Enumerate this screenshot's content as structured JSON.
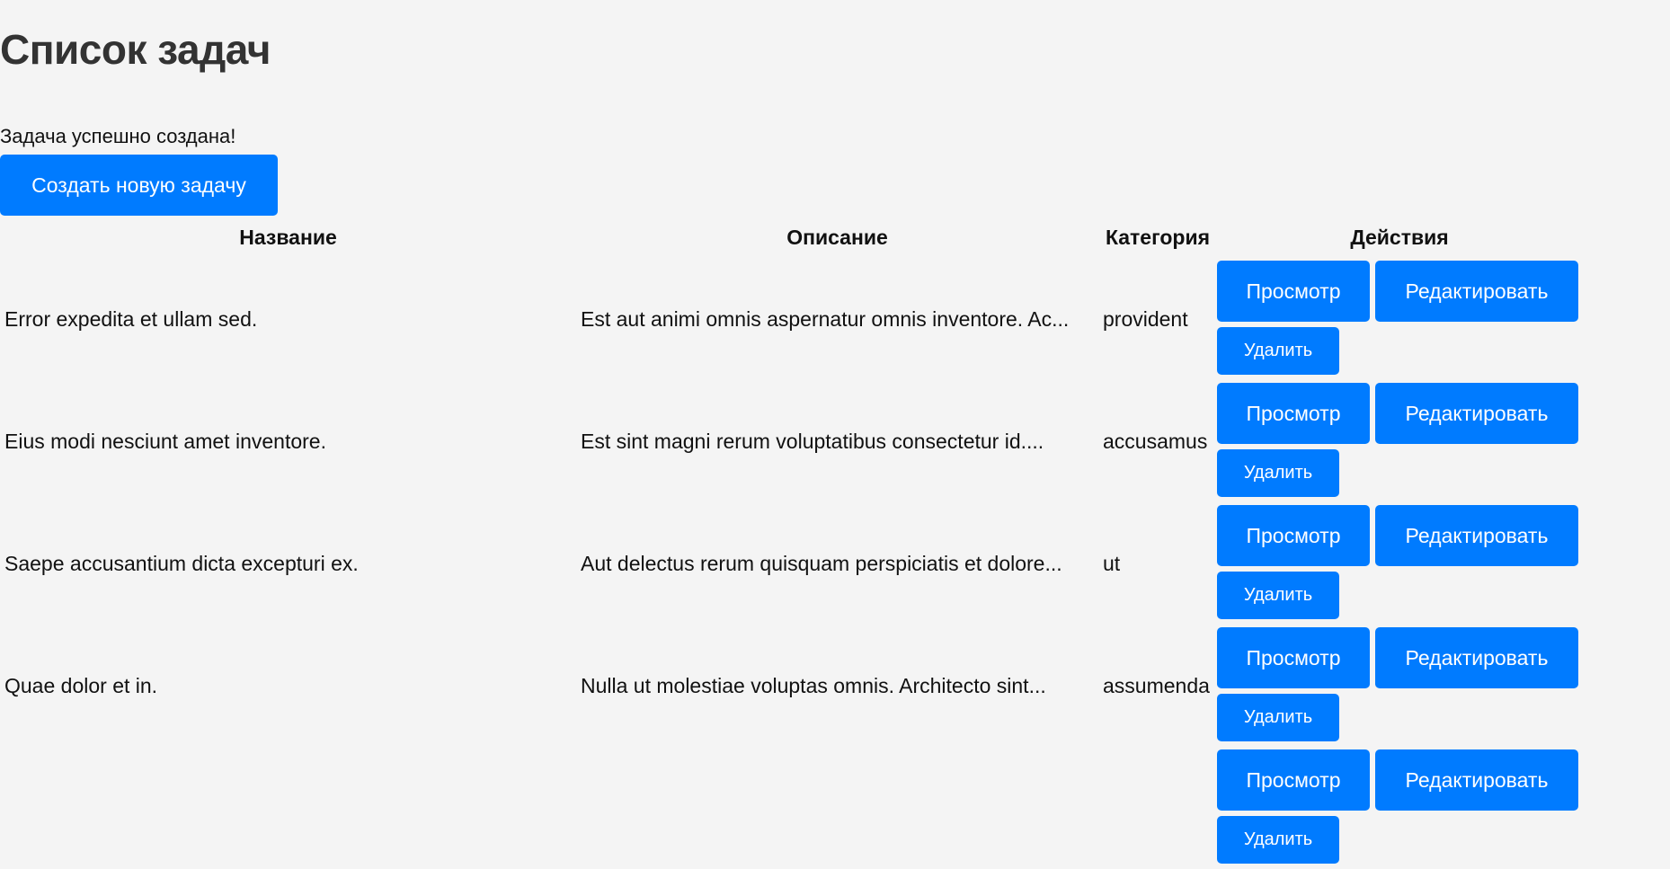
{
  "header": {
    "title": "Список задач"
  },
  "flash": {
    "message": "Задача успешно создана!"
  },
  "toolbar": {
    "create_label": "Создать новую задачу"
  },
  "table": {
    "columns": [
      "Название",
      "Описание",
      "Категория",
      "Действия"
    ],
    "rows": [
      {
        "title": "Error expedita et ullam sed.",
        "description": "Est aut animi omnis aspernatur omnis inventore. Ac...",
        "category": "provident"
      },
      {
        "title": "Eius modi nesciunt amet inventore.",
        "description": "Est sint magni rerum voluptatibus consectetur id....",
        "category": "accusamus"
      },
      {
        "title": "Saepe accusantium dicta excepturi ex.",
        "description": "Aut delectus rerum quisquam perspiciatis et dolore...",
        "category": "ut"
      },
      {
        "title": "Quae dolor et in.",
        "description": "Nulla ut molestiae voluptas omnis. Architecto sint...",
        "category": "assumenda"
      },
      {
        "title": "",
        "description": "",
        "category": ""
      }
    ],
    "actions": {
      "view_label": "Просмотр",
      "edit_label": "Редактировать",
      "delete_label": "Удалить"
    }
  },
  "colors": {
    "accent": "#007bff",
    "background": "#f4f4f4",
    "title_text": "#333333"
  }
}
